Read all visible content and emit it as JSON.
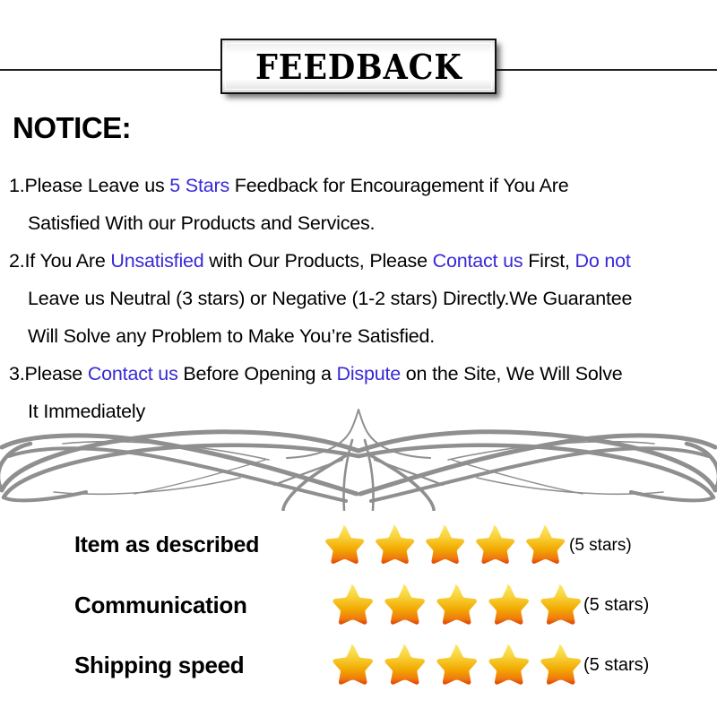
{
  "header": {
    "title": "FEEDBACK"
  },
  "notice": {
    "heading": "NOTICE:",
    "lines": [
      {
        "indent": "lead",
        "segments": [
          {
            "text": "1.Please Leave us ",
            "highlight": false
          },
          {
            "text": " 5 Stars ",
            "highlight": true
          },
          {
            "text": " Feedback for  Encouragement  if You Are",
            "highlight": false
          }
        ]
      },
      {
        "indent": "cont",
        "segments": [
          {
            "text": "Satisfied With our Products and Services.",
            "highlight": false
          }
        ]
      },
      {
        "indent": "lead",
        "segments": [
          {
            "text": "2.If You Are ",
            "highlight": false
          },
          {
            "text": "Unsatisfied",
            "highlight": true
          },
          {
            "text": " with Our Products, Please ",
            "highlight": false
          },
          {
            "text": "Contact us",
            "highlight": true
          },
          {
            "text": " First, ",
            "highlight": false
          },
          {
            "text": "Do not",
            "highlight": true
          }
        ]
      },
      {
        "indent": "cont",
        "segments": [
          {
            "text": "Leave us Neutral (3 stars) or Negative (1-2 stars) Directly.We Guarantee",
            "highlight": false
          }
        ]
      },
      {
        "indent": "cont",
        "segments": [
          {
            "text": "Will Solve any Problem to Make You’re  Satisfied.",
            "highlight": false
          }
        ]
      },
      {
        "indent": "lead",
        "segments": [
          {
            "text": "3.Please ",
            "highlight": false
          },
          {
            "text": "Contact us",
            "highlight": true
          },
          {
            "text": " Before Opening a ",
            "highlight": false
          },
          {
            "text": "Dispute",
            "highlight": true
          },
          {
            "text": " on the Site, We Will Solve",
            "highlight": false
          }
        ]
      },
      {
        "indent": "cont",
        "segments": [
          {
            "text": "It Immediately",
            "highlight": false
          }
        ]
      }
    ]
  },
  "ratings": [
    {
      "label": "Item as described",
      "stars": 5,
      "caption": "(5 stars)"
    },
    {
      "label": "Communication",
      "stars": 5,
      "caption": "(5 stars)"
    },
    {
      "label": "Shipping speed",
      "stars": 5,
      "caption": "(5 stars)"
    }
  ],
  "colors": {
    "highlight_text": "#3729d6",
    "body_text": "#000000",
    "star_top": "#fbe96b",
    "star_mid": "#f2a900",
    "star_bottom": "#e04000",
    "ornament": "#8f8f8f",
    "rule": "#222222"
  },
  "icons": {
    "star": "star-icon",
    "ornament": "flourish-divider-icon"
  }
}
